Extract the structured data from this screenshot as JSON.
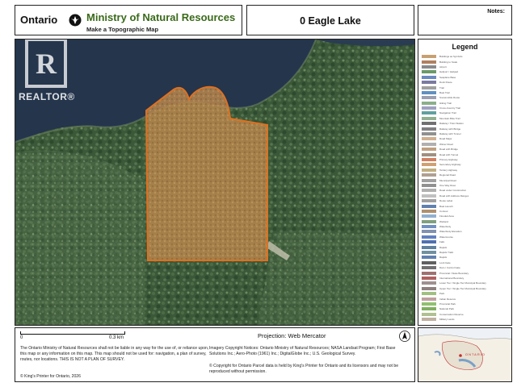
{
  "header": {
    "province": "Ontario",
    "ministry": "Ministry of Natural Resources",
    "subtitle": "Make a Topographic Map",
    "place_name": "0 Eagle Lake",
    "notes_label": "Notes:"
  },
  "legend": {
    "title": "Legend",
    "items": [
      {
        "label": "Buildings as Symbols",
        "color": "#c8a070"
      },
      {
        "label": "Building to Scale",
        "color": "#b08060"
      },
      {
        "label": "Airport",
        "color": "#8a8a8a"
      },
      {
        "label": "Heliport / Helipad",
        "color": "#6a9a6a"
      },
      {
        "label": "Seaplane Base",
        "color": "#6a8ac0"
      },
      {
        "label": "Dock Route",
        "color": "#7a7aa0"
      },
      {
        "label": "Trail",
        "color": "#a0a0a0"
      },
      {
        "label": "Boat Trail",
        "color": "#6090c0"
      },
      {
        "label": "Snowmobile Route",
        "color": "#9aa0b0"
      },
      {
        "label": "Hiking Trail",
        "color": "#8ab08a"
      },
      {
        "label": "Cross-Country Trail",
        "color": "#a0a0c0"
      },
      {
        "label": "Navigation Trail",
        "color": "#60a0a0"
      },
      {
        "label": "Mountain Bike Trail",
        "color": "#90b090"
      },
      {
        "label": "Railway / Train Station",
        "color": "#707070"
      },
      {
        "label": "Railway with Bridge",
        "color": "#808080"
      },
      {
        "label": "Railway with Tunnel",
        "color": "#909090"
      },
      {
        "label": "Road Major",
        "color": "#d0b090"
      },
      {
        "label": "Winter Road",
        "color": "#b0b0b0"
      },
      {
        "label": "Road with Bridge",
        "color": "#c0a080"
      },
      {
        "label": "Road with Tunnel",
        "color": "#a09080"
      },
      {
        "label": "Primary Highway",
        "color": "#d08060"
      },
      {
        "label": "Secondary Highway",
        "color": "#d0a070"
      },
      {
        "label": "Tertiary Highway",
        "color": "#c0b080"
      },
      {
        "label": "Regional Road",
        "color": "#b0a090"
      },
      {
        "label": "Municipal Road",
        "color": "#a0a0a0"
      },
      {
        "label": "One Way Road",
        "color": "#909090"
      },
      {
        "label": "Road under Construction",
        "color": "#b0b0b0"
      },
      {
        "label": "Road with Address Ranges",
        "color": "#c0c0c0"
      },
      {
        "label": "Route Label",
        "color": "#a0a0a0"
      },
      {
        "label": "Boat Launch",
        "color": "#6080b0"
      },
      {
        "label": "Contour",
        "color": "#b09070"
      },
      {
        "label": "Flooded Area",
        "color": "#90b0d0"
      },
      {
        "label": "Wetland",
        "color": "#80a080"
      },
      {
        "label": "Waterbody",
        "color": "#7090c0"
      },
      {
        "label": "Waterbody Elevation",
        "color": "#8090b0"
      },
      {
        "label": "Watercourse",
        "color": "#6080c0"
      },
      {
        "label": "Falls",
        "color": "#5070b0"
      },
      {
        "label": "Rapids",
        "color": "#6080a0"
      },
      {
        "label": "Rapids Trails",
        "color": "#7090a0"
      },
      {
        "label": "Rapids",
        "color": "#6080b0"
      },
      {
        "label": "Lock Gate",
        "color": "#606060"
      },
      {
        "label": "Dam / Control Gate",
        "color": "#707070"
      },
      {
        "label": "Provincial / State Boundary",
        "color": "#a07070"
      },
      {
        "label": "International Boundary",
        "color": "#b06060"
      },
      {
        "label": "Lower Tier / Single Tier Municipal Boundary",
        "color": "#a09090"
      },
      {
        "label": "Upper Tier / Single Tier Municipal Boundary",
        "color": "#908080"
      },
      {
        "label": "Park",
        "color": "#a0c080"
      },
      {
        "label": "Indian Reserve",
        "color": "#c0a0a0"
      },
      {
        "label": "Provincial Park",
        "color": "#90c070"
      },
      {
        "label": "National Park",
        "color": "#80b060"
      },
      {
        "label": "Conservation Reserve",
        "color": "#b0c090"
      },
      {
        "label": "Military Lands",
        "color": "#c0b0a0"
      }
    ]
  },
  "scale": {
    "start": "0",
    "end": "0.3 km"
  },
  "projection": "Projection: Web Mercator",
  "disclaimer": "The Ontario Ministry of Natural Resources shall not be liable in any way for the use of, or reliance upon, this map or any information on this map. This map should not be used for: navigation, a plan of survey, routes, nor locations. THIS IS NOT A PLAN OF SURVEY.",
  "imagery_notice": "Imagery Copyright Notices: Ontario Ministry of Natural Resources; NASA Landsat Program; First Base Solutions Inc.; Aero-Photo (1961) Inc.; DigitalGlobe Inc.; U.S. Geological Survey.",
  "copyright_left": "© King's Printer for Ontario, 2026",
  "copyright_right": "© Copyright for Ontario Parcel data is held by King's Printer for Ontario and its licensors and may not be reproduced without permission.",
  "inset_label": "ONTARIO",
  "watermark": "REALTOR®",
  "colors": {
    "lake": "#24354c",
    "forest": "#3d5a3a",
    "parcel_fill": "#c88a4a",
    "parcel_stroke": "#e07020",
    "ministry_green": "#3a6a1a"
  }
}
